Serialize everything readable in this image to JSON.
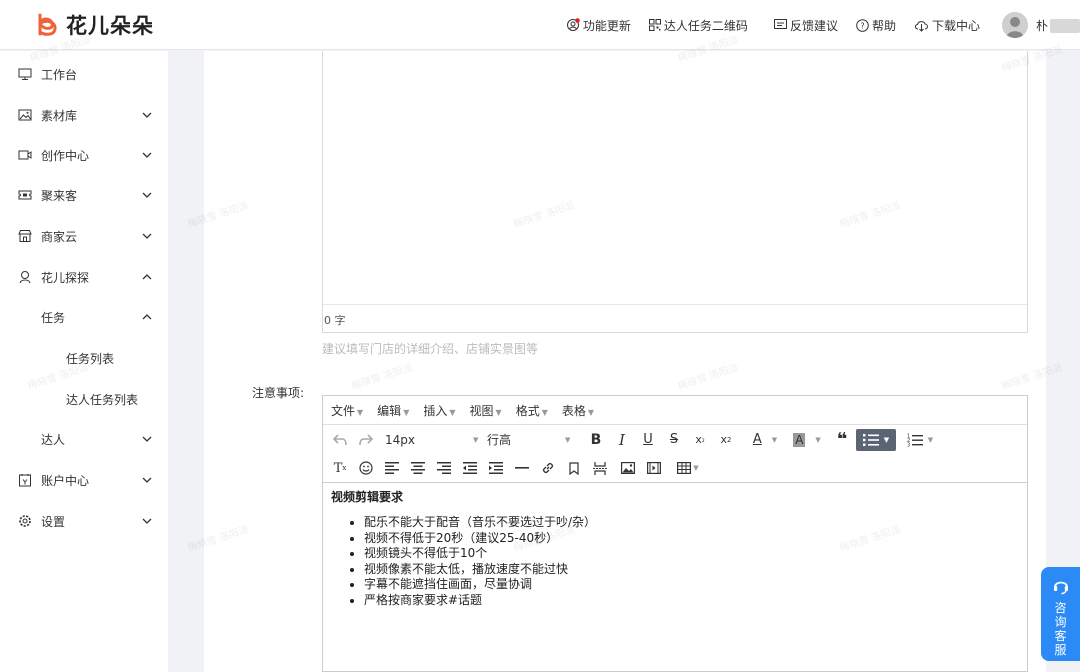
{
  "header": {
    "brand": "花儿朵朵",
    "nav": [
      {
        "label": "功能更新",
        "icon": "update-icon"
      },
      {
        "label": "达人任务二维码",
        "icon": "qrcode-icon"
      },
      {
        "label": "反馈建议",
        "icon": "feedback-icon"
      },
      {
        "label": "帮助",
        "icon": "help-icon"
      },
      {
        "label": "下载中心",
        "icon": "download-icon"
      }
    ],
    "user_initial": "朴"
  },
  "sidebar": {
    "items": [
      {
        "label": "工作台",
        "icon": "monitor-icon"
      },
      {
        "label": "素材库",
        "icon": "image-icon",
        "expanded": false
      },
      {
        "label": "创作中心",
        "icon": "video-icon",
        "expanded": false
      },
      {
        "label": "聚来客",
        "icon": "ticket-icon",
        "expanded": false
      },
      {
        "label": "商家云",
        "icon": "store-icon",
        "expanded": false
      },
      {
        "label": "花儿探探",
        "icon": "explore-icon",
        "expanded": true
      },
      {
        "label": "任务",
        "expanded": true
      },
      {
        "label": "任务列表"
      },
      {
        "label": "达人任务列表"
      },
      {
        "label": "达人",
        "expanded": false
      },
      {
        "label": "账户中心",
        "icon": "account-icon",
        "expanded": false
      },
      {
        "label": "设置",
        "icon": "gear-icon",
        "expanded": false
      }
    ]
  },
  "form": {
    "char_count": "0 字",
    "hint": "建议填写门店的详细介绍、店铺实景图等",
    "notes_label": "注意事项:"
  },
  "editor": {
    "menus": [
      "文件",
      "编辑",
      "插入",
      "视图",
      "格式",
      "表格"
    ],
    "font_size": "14px",
    "line_height": "行高",
    "heading": "视频剪辑要求",
    "bullets": [
      "配乐不能大于配音（音乐不要选过于吵/杂）",
      "视频不得低于20秒（建议25-40秒）",
      "视频镜头不得低于10个",
      "视频像素不能太低，播放速度不能过快",
      "字幕不能遮挡住画面，尽量协调",
      "严格按商家要求#话题"
    ]
  },
  "consult": {
    "label": "咨询客服"
  },
  "watermark": "梅晓雪 洛阳派",
  "colors": {
    "brand": "#f0633a",
    "accent": "#2b8af5",
    "active_tool": "#5a6473"
  }
}
